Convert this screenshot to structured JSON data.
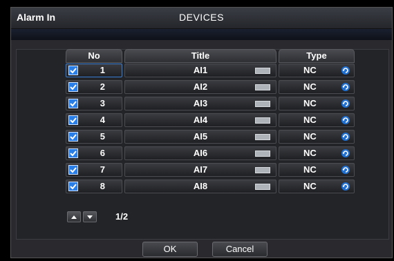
{
  "window": {
    "section_label": "Alarm In",
    "title": "DEVICES"
  },
  "table": {
    "headers": {
      "no": "No",
      "title": "Title",
      "type": "Type"
    },
    "rows": [
      {
        "no": "1",
        "title": "AI1",
        "type": "NC",
        "checked": true
      },
      {
        "no": "2",
        "title": "AI2",
        "type": "NC",
        "checked": true
      },
      {
        "no": "3",
        "title": "AI3",
        "type": "NC",
        "checked": true
      },
      {
        "no": "4",
        "title": "AI4",
        "type": "NC",
        "checked": true
      },
      {
        "no": "5",
        "title": "AI5",
        "type": "NC",
        "checked": true
      },
      {
        "no": "6",
        "title": "AI6",
        "type": "NC",
        "checked": true
      },
      {
        "no": "7",
        "title": "AI7",
        "type": "NC",
        "checked": true
      },
      {
        "no": "8",
        "title": "AI8",
        "type": "NC",
        "checked": true
      }
    ]
  },
  "pager": {
    "page": "1/2"
  },
  "buttons": {
    "ok": "OK",
    "cancel": "Cancel"
  },
  "colors": {
    "accent": "#2a7ee8",
    "selected_border": "#3a7fd8"
  },
  "icons": {
    "checkbox": "check-icon",
    "keyboard": "keyboard-icon",
    "type_toggle": "refresh-icon",
    "page_up": "arrow-up-icon",
    "page_down": "arrow-down-icon"
  }
}
